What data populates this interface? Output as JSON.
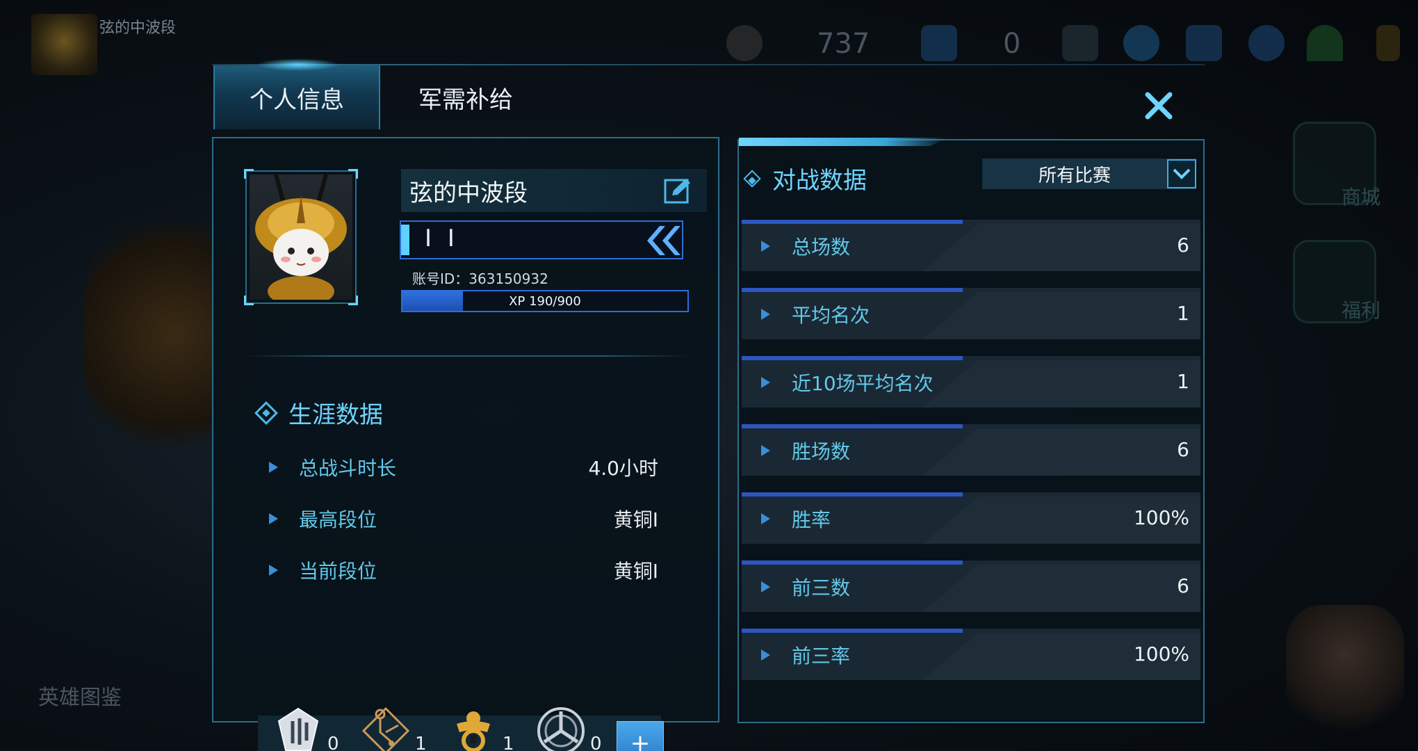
{
  "background": {
    "player_name": "弦的中波段",
    "currency_amount": "737",
    "gem_amount": "0",
    "bottom_left_label": "英雄图鉴",
    "right_menu": [
      "商城",
      "福利"
    ]
  },
  "tabs": [
    {
      "label": "个人信息",
      "active": true
    },
    {
      "label": "军需补给",
      "active": false
    }
  ],
  "profile": {
    "name": "弦的中波段",
    "rank_bar_value": "I I",
    "account_id": "账号ID：363150932",
    "xp_text": "XP 190/900",
    "xp_fraction": 0.211
  },
  "career": {
    "title": "生涯数据",
    "rows": [
      {
        "label": "总战斗时长",
        "value": "4.0小时"
      },
      {
        "label": "最高段位",
        "value": "黄铜I"
      },
      {
        "label": "当前段位",
        "value": "黄铜I"
      }
    ]
  },
  "badges": [
    {
      "icon": "white-shield-badge-icon",
      "count": "0"
    },
    {
      "icon": "gold-circuit-badge-icon",
      "count": "1"
    },
    {
      "icon": "gold-ring-badge-icon",
      "count": "1"
    },
    {
      "icon": "silver-wheel-badge-icon",
      "count": "0"
    }
  ],
  "battle": {
    "title": "对战数据",
    "filter": "所有比赛",
    "rows": [
      {
        "label": "总场数",
        "value": "6"
      },
      {
        "label": "平均名次",
        "value": "1"
      },
      {
        "label": "近10场平均名次",
        "value": "1"
      },
      {
        "label": "胜场数",
        "value": "6"
      },
      {
        "label": "胜率",
        "value": "100%"
      },
      {
        "label": "前三数",
        "value": "6"
      },
      {
        "label": "前三率",
        "value": "100%"
      }
    ]
  },
  "colors": {
    "accent": "#6fd4ff",
    "label_cyan": "#62c8ea",
    "bar_blue": "#2d56c0",
    "panel_border": "#2c6e8a"
  }
}
